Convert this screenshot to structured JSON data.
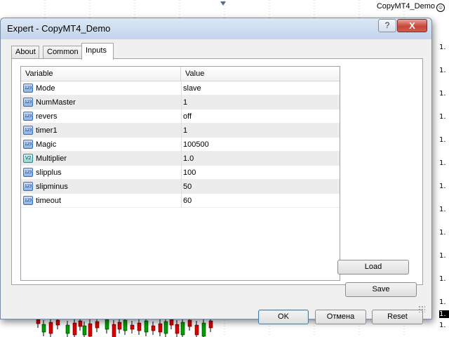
{
  "chart": {
    "title": "CopyMT4_Demo",
    "price_labels": [
      "1.",
      "1.",
      "1.",
      "1.",
      "1.",
      "1.",
      "1.",
      "1.",
      "1.",
      "1.",
      "1.",
      "1.",
      "1.",
      "1."
    ],
    "current_price_label": "1."
  },
  "dialog": {
    "title": "Expert - CopyMT4_Demo",
    "help_label": "?",
    "close_label": "X",
    "tabs": [
      {
        "label": "About",
        "active": false
      },
      {
        "label": "Common",
        "active": false
      },
      {
        "label": "Inputs",
        "active": true
      }
    ],
    "grid": {
      "columns": [
        "Variable",
        "Value"
      ],
      "rows": [
        {
          "icon": "123",
          "name": "Mode",
          "value": "slave"
        },
        {
          "icon": "123",
          "name": "NumMaster",
          "value": "1"
        },
        {
          "icon": "123",
          "name": "revers",
          "value": "off"
        },
        {
          "icon": "123",
          "name": "timer1",
          "value": "1"
        },
        {
          "icon": "123",
          "name": "Magic",
          "value": "100500"
        },
        {
          "icon": "V2",
          "name": "Multiplier",
          "value": "1.0"
        },
        {
          "icon": "123",
          "name": "slipplus",
          "value": "100"
        },
        {
          "icon": "123",
          "name": "slipminus",
          "value": "50"
        },
        {
          "icon": "123",
          "name": "timeout",
          "value": "60"
        }
      ]
    },
    "buttons": {
      "load": "Load",
      "save": "Save",
      "ok": "OK",
      "cancel": "Отмена",
      "reset": "Reset"
    }
  },
  "colors": {
    "bull_candle": "#00a000",
    "bear_candle": "#e00000"
  }
}
